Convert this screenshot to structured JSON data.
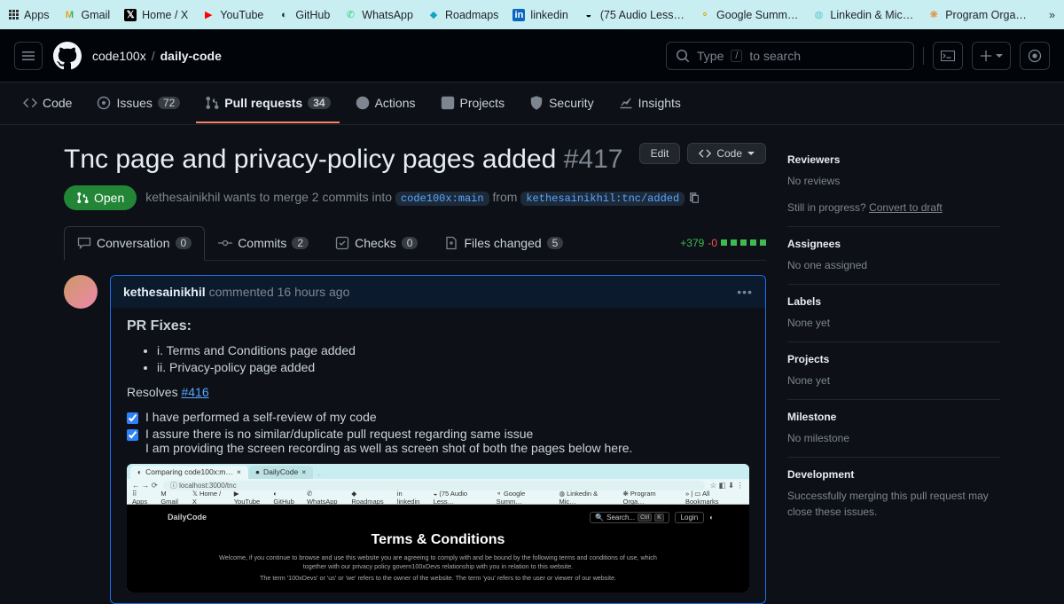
{
  "bookmarks": {
    "apps": "Apps",
    "gmail": "Gmail",
    "home_x": "Home / X",
    "youtube": "YouTube",
    "github": "GitHub",
    "whatsapp": "WhatsApp",
    "roadmaps": "Roadmaps",
    "linkedin": "linkedin",
    "audio": "(75 Audio Less…",
    "google_summ": "Google Summ…",
    "linkedin_mic": "Linkedin & Mic…",
    "program_orga": "Program Orga…"
  },
  "header": {
    "owner": "code100x",
    "repo": "daily-code",
    "search_placeholder": "Type",
    "search_after_kbd": "to search",
    "search_kbd": "/"
  },
  "nav": {
    "code": "Code",
    "issues": "Issues",
    "issues_count": "72",
    "pulls": "Pull requests",
    "pulls_count": "34",
    "actions": "Actions",
    "projects": "Projects",
    "security": "Security",
    "insights": "Insights"
  },
  "pr": {
    "title": "Tnc page and privacy-policy pages added",
    "number": "#417",
    "edit": "Edit",
    "code_btn": "Code",
    "state": "Open",
    "author": "kethesainikhil",
    "merge_desc_1": "wants to merge 2 commits into",
    "base_branch": "code100x:main",
    "merge_desc_2": "from",
    "head_branch": "kethesainikhil:tnc/added"
  },
  "tabs": {
    "conversation": "Conversation",
    "conversation_count": "0",
    "commits": "Commits",
    "commits_count": "2",
    "checks": "Checks",
    "checks_count": "0",
    "files": "Files changed",
    "files_count": "5",
    "diff_add": "+379",
    "diff_del": "-0"
  },
  "comment": {
    "author": "kethesainikhil",
    "time_prefix": "commented",
    "time": "16 hours ago",
    "heading": "PR Fixes:",
    "li1": "i. Terms and Conditions page added",
    "li2": "ii. Privacy-policy page added",
    "resolves_label": "Resolves ",
    "resolves_link": "#416",
    "task1": "I have performed a self-review of my code",
    "task2": "I assure there is no similar/duplicate pull request regarding same issue",
    "task2_cont": "I am providing the screen recording as well as screen shot of both the pages below here."
  },
  "embed": {
    "tab1": "Comparing code100x:m…",
    "tab2": "DailyCode",
    "url": "localhost:3000/tnc",
    "bm_apps": "Apps",
    "bm_gmail": "Gmail",
    "bm_homex": "Home / X",
    "bm_youtube": "YouTube",
    "bm_github": "GitHub",
    "bm_whatsapp": "WhatsApp",
    "bm_roadmaps": "Roadmaps",
    "bm_linkedin": "linkedin",
    "bm_audio": "(75 Audio Less…",
    "bm_gsumm": "Google Summ…",
    "bm_lmic": "Linkedin & Mic…",
    "bm_porg": "Program Orga…",
    "bm_all": "All Bookmarks",
    "brand": "DailyCode",
    "search": "Search...",
    "kbd1": "Ctrl",
    "kbd2": "K",
    "login": "Login",
    "h1": "Terms & Conditions",
    "p1": "Welcome, if you continue to browse and use this website you are agreeing to comply with and be bound by the following terms and conditions of use, which together with our privacy policy govern100xDevs relationship with you in relation to this website.",
    "p2": "The term '100xDevs' or 'us' or 'we' refers to the owner of the website. The term 'you' refers to the user or viewer of our website."
  },
  "sidebar": {
    "reviewers": "Reviewers",
    "reviewers_val": "No reviews",
    "draft_q": "Still in progress?",
    "draft_link": "Convert to draft",
    "assignees": "Assignees",
    "assignees_val": "No one assigned",
    "labels": "Labels",
    "labels_val": "None yet",
    "projects": "Projects",
    "projects_val": "None yet",
    "milestone": "Milestone",
    "milestone_val": "No milestone",
    "development": "Development",
    "development_val": "Successfully merging this pull request may close these issues."
  }
}
